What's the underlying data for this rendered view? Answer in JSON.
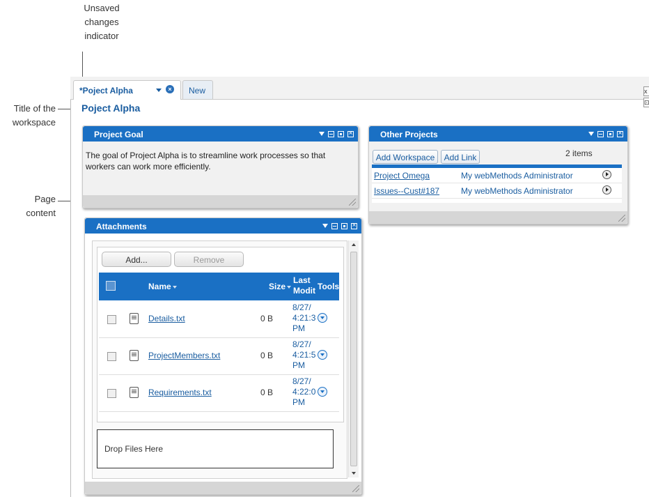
{
  "callouts": {
    "unsaved_line1": "Unsaved",
    "unsaved_line2": "changes",
    "unsaved_line3": "indicator",
    "title_line1": "Title of the",
    "title_line2": "workspace",
    "page_line1": "Page",
    "page_line2": "content"
  },
  "tabs": {
    "active_label": "*Poject Alpha",
    "new_label": "New",
    "edge_top": "x",
    "edge_bottom": "⊡"
  },
  "workspace_title": "Poject Alpha",
  "project_goal": {
    "title": "Project Goal",
    "text": "The goal of Project Alpha is to streamline work processes so that workers can work more efficiently."
  },
  "other_projects": {
    "title": "Other Projects",
    "add_workspace": "Add Workspace",
    "add_link": "Add Link",
    "count": "2 items",
    "rows": [
      {
        "name": "Project Omega",
        "owner": "My webMethods Administrator"
      },
      {
        "name": "Issues--Cust#187",
        "owner": "My webMethods Administrator"
      }
    ]
  },
  "attachments": {
    "title": "Attachments",
    "add": "Add...",
    "remove": "Remove",
    "headers": {
      "name": "Name",
      "size": "Size",
      "modified_1": "Last",
      "modified_2": "Modit",
      "tools": "Tools"
    },
    "rows": [
      {
        "name": "Details.txt",
        "size": "0 B",
        "d1": "8/27/",
        "d2": "4:21:3",
        "d3": "PM"
      },
      {
        "name": "ProjectMembers.txt",
        "size": "0 B",
        "d1": "8/27/",
        "d2": "4:21:5",
        "d3": "PM"
      },
      {
        "name": "Requirements.txt",
        "size": "0 B",
        "d1": "8/27/",
        "d2": "4:22:0",
        "d3": "PM"
      }
    ],
    "drop_text": "Drop Files Here"
  },
  "colors": {
    "accent": "#1a70c4",
    "link": "#1a5da0",
    "footer": "#d6d6d6"
  }
}
